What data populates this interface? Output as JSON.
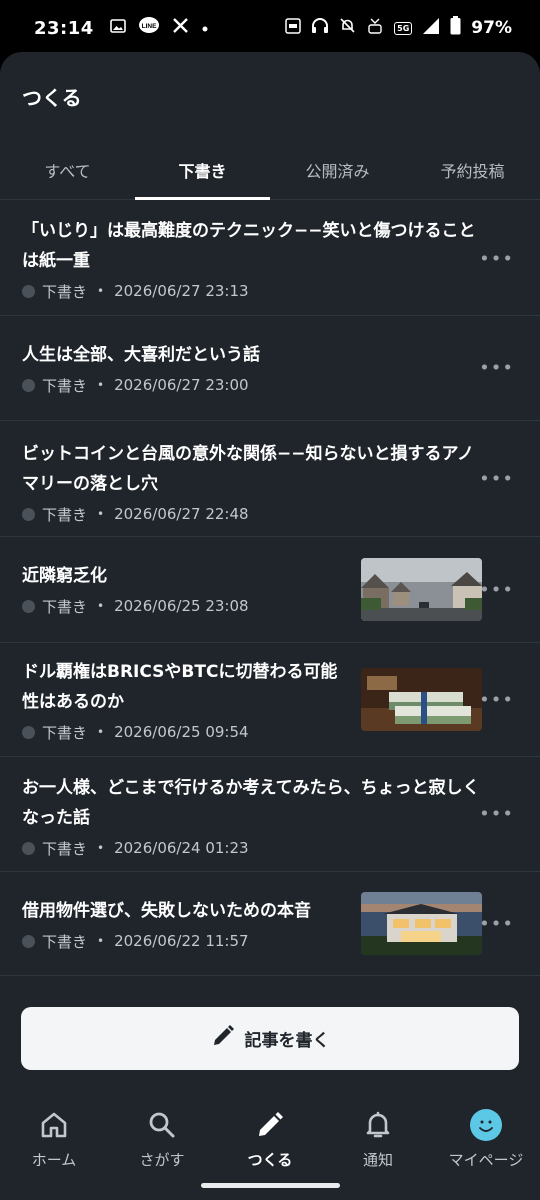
{
  "status_bar": {
    "time": "23:14",
    "signal": "5G",
    "battery": "97%",
    "left_icons": [
      "image-icon",
      "line-icon",
      "x-icon",
      "dot-icon"
    ],
    "right_icons": [
      "auto-icon",
      "headphones-icon",
      "bell-off-icon",
      "volte-icon",
      "signal-icon",
      "battery-icon"
    ],
    "line_label": "LINE"
  },
  "sheet": {
    "title": "つくる"
  },
  "tabs": [
    {
      "label": "すべて",
      "active": false
    },
    {
      "label": "下書き",
      "active": true
    },
    {
      "label": "公開済み",
      "active": false
    },
    {
      "label": "予約投稿",
      "active": false
    }
  ],
  "articles": [
    {
      "title": "「いじり」は最高難度のテクニック−−笑いと傷つけることは紙一重",
      "status": "下書き",
      "date": "2026/06/27 23:13",
      "thumb": null
    },
    {
      "title": "人生は全部、大喜利だという話",
      "status": "下書き",
      "date": "2026/06/27 23:00",
      "thumb": null
    },
    {
      "title": "ビットコインと台風の意外な関係−−知らないと損するアノマリーの落とし穴",
      "status": "下書き",
      "date": "2026/06/27 22:48",
      "thumb": null
    },
    {
      "title": "近隣窮乏化",
      "status": "下書き",
      "date": "2026/06/25 23:08",
      "thumb": "street-houses"
    },
    {
      "title": "ドル覇権はBRICSやBTCに切替わる可能性はあるのか",
      "status": "下書き",
      "date": "2026/06/25 09:54",
      "thumb": "money-stacks"
    },
    {
      "title": "お一人様、どこまで行けるか考えてみたら、ちょっと寂しくなった話",
      "status": "下書き",
      "date": "2026/06/24 01:23",
      "thumb": null
    },
    {
      "title": "借用物件選び、失敗しないための本音",
      "status": "下書き",
      "date": "2026/06/22 11:57",
      "thumb": "modern-house"
    }
  ],
  "more_glyph": "•••",
  "meta_separator": "•",
  "write_button": {
    "label": "記事を書く",
    "icon": "pencil-icon"
  },
  "bottom_nav": [
    {
      "label": "ホーム",
      "icon": "home-icon",
      "active": false
    },
    {
      "label": "さがす",
      "icon": "search-icon",
      "active": false
    },
    {
      "label": "つくる",
      "icon": "pencil-icon",
      "active": true
    },
    {
      "label": "通知",
      "icon": "bell-icon",
      "active": false
    },
    {
      "label": "マイページ",
      "icon": "avatar-icon",
      "active": false
    }
  ],
  "colors": {
    "background": "#1f252b",
    "divider": "#2e353c",
    "button_bg": "#f4f5f7",
    "avatar": "#5cc8e6"
  }
}
